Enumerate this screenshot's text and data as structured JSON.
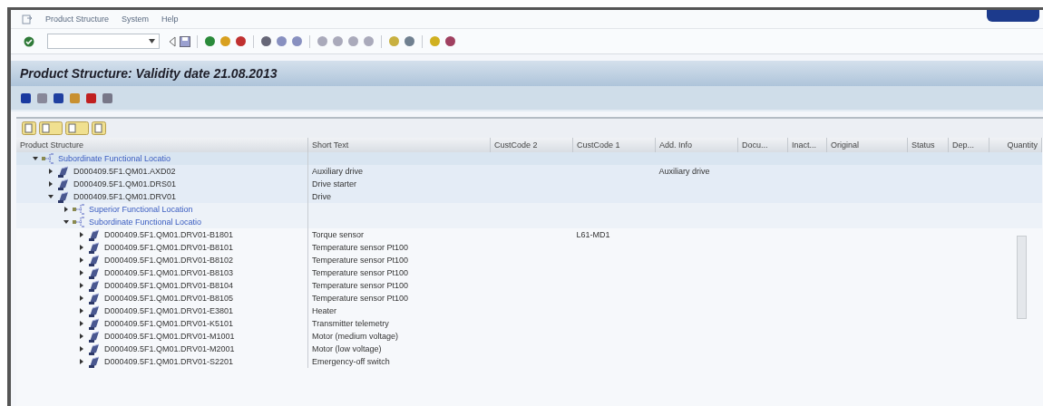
{
  "menu": [
    "Product Structure",
    "System",
    "Help"
  ],
  "title": "Product Structure: Validity date 21.08.2013",
  "table": {
    "columns": [
      "Product Structure",
      "Short Text",
      "CustCode 2",
      "CustCode 1",
      "Add. Info",
      "Docu...",
      "Inact...",
      "Original",
      "Status",
      "Dep...",
      "Quantity"
    ],
    "rows": [
      {
        "kind": "location",
        "label": "Subordinate Functional Locatio",
        "expanded": true,
        "children": [
          {
            "kind": "equipment",
            "label": "D000409.5F1.QM01.AXD02",
            "short_text": "Auxiliary drive",
            "add_info": "Auxiliary drive",
            "expanded": false
          },
          {
            "kind": "equipment",
            "label": "D000409.5F1.QM01.DRS01",
            "short_text": "Drive starter",
            "expanded": false
          },
          {
            "kind": "equipment",
            "label": "D000409.5F1.QM01.DRV01",
            "short_text": "Drive",
            "expanded": true,
            "children": [
              {
                "kind": "location",
                "label": "Superior Functional Location",
                "expanded": false
              },
              {
                "kind": "location",
                "label": "Subordinate Functional Locatio",
                "expanded": true,
                "children": [
                  {
                    "kind": "equipment",
                    "label": "D000409.5F1.QM01.DRV01-B1801",
                    "short_text": "Torque sensor",
                    "custcode_1": "L61-MD1",
                    "expanded": false
                  },
                  {
                    "kind": "equipment",
                    "label": "D000409.5F1.QM01.DRV01-B8101",
                    "short_text": "Temperature sensor Pt100",
                    "expanded": false
                  },
                  {
                    "kind": "equipment",
                    "label": "D000409.5F1.QM01.DRV01-B8102",
                    "short_text": "Temperature sensor Pt100",
                    "expanded": false
                  },
                  {
                    "kind": "equipment",
                    "label": "D000409.5F1.QM01.DRV01-B8103",
                    "short_text": "Temperature sensor Pt100",
                    "expanded": false
                  },
                  {
                    "kind": "equipment",
                    "label": "D000409.5F1.QM01.DRV01-B8104",
                    "short_text": "Temperature sensor Pt100",
                    "expanded": false
                  },
                  {
                    "kind": "equipment",
                    "label": "D000409.5F1.QM01.DRV01-B8105",
                    "short_text": "Temperature sensor Pt100",
                    "expanded": false
                  },
                  {
                    "kind": "equipment",
                    "label": "D000409.5F1.QM01.DRV01-E3801",
                    "short_text": "Heater",
                    "expanded": false
                  },
                  {
                    "kind": "equipment",
                    "label": "D000409.5F1.QM01.DRV01-K5101",
                    "short_text": "Transmitter telemetry",
                    "expanded": false
                  },
                  {
                    "kind": "equipment",
                    "label": "D000409.5F1.QM01.DRV01-M1001",
                    "short_text": "Motor (medium voltage)",
                    "expanded": false
                  },
                  {
                    "kind": "equipment",
                    "label": "D000409.5F1.QM01.DRV01-M2001",
                    "short_text": "Motor (low voltage)",
                    "expanded": false
                  },
                  {
                    "kind": "equipment",
                    "label": "D000409.5F1.QM01.DRV01-S2201",
                    "short_text": "Emergency-off switch",
                    "expanded": false
                  }
                ]
              }
            ]
          }
        ]
      }
    ]
  }
}
